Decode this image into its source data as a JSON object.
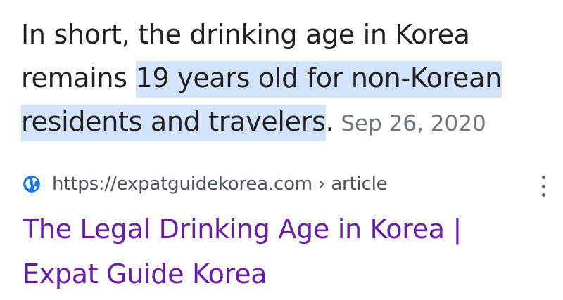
{
  "snippet": {
    "text_before": "In short, the drinking age in Korea remains ",
    "highlight": "19 years old for non-Korean residents and travelers",
    "text_after": ".",
    "date": "Sep 26, 2020"
  },
  "result": {
    "url": "https://expatguidekorea.com › article",
    "title": "The Legal Drinking Age in Korea | Expat Guide Korea",
    "title_color": "#681da8",
    "favicon": "globe-icon",
    "menu_icon": "more-vert-icon"
  },
  "colors": {
    "highlight_bg": "#d3e3fd",
    "text": "#202124",
    "date": "#70757a"
  }
}
